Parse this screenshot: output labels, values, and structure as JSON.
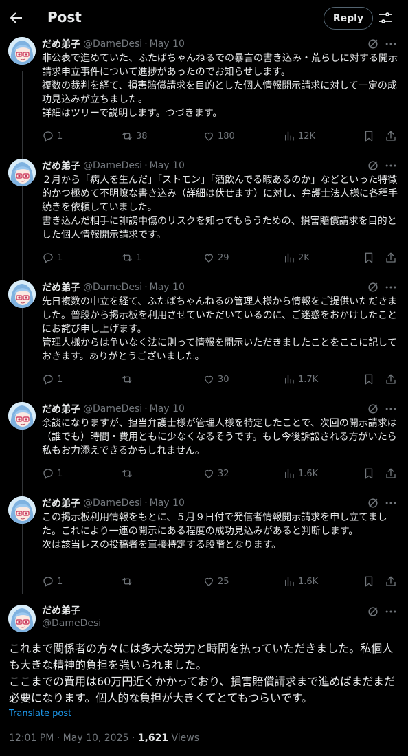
{
  "header": {
    "title": "Post",
    "reply_label": "Reply"
  },
  "author": {
    "name": "だめ弟子",
    "handle": "@DameDesi"
  },
  "thread": [
    {
      "date": "May 10",
      "text": "非公表で進めていた、ふたばちゃんねるでの暴言の書き込み・荒らしに対する開示請求申立事件について進捗があったのでお知らせします。\n複数の裁判を経て、損害賠償請求を目的とした個人情報開示請求に対して一定の成功見込みが立ちました。\n詳細はツリーで説明します。つづきます。",
      "replies": "1",
      "retweets": "38",
      "likes": "180",
      "views": "12K"
    },
    {
      "date": "May 10",
      "text": "２月から「病人を生んだ」「ストモン」「酒飲んでる暇あるのか」などといった特徴的かつ極めて不明瞭な書き込み（詳細は伏せます）に対し、弁護士法人様に各種手続きを依頼していました。\n書き込んだ相手に誹謗中傷のリスクを知ってもらうための、損害賠償請求を目的とした個人情報開示請求です。",
      "replies": "1",
      "retweets": "1",
      "likes": "29",
      "views": "2K"
    },
    {
      "date": "May 10",
      "text": "先日複数の申立を経て、ふたばちゃんねるの管理人様から情報をご提供いただきました。普段から掲示板を利用させていただいているのに、ご迷惑をおかけしたことにお詫び申し上げます。\n管理人様からは争いなく法に則って情報を開示いただきましたことをここに記しておきます。ありがとうございました。",
      "replies": "1",
      "retweets": "",
      "likes": "30",
      "views": "1.7K"
    },
    {
      "date": "May 10",
      "text": "余談になりますが、担当弁護士様が管理人様を特定したことで、次回の開示請求は（誰でも）時間・費用ともに少なくなるそうです。もし今後訴訟される方がいたら私もお力添えできるかもしれません。",
      "replies": "1",
      "retweets": "",
      "likes": "32",
      "views": "1.6K"
    },
    {
      "date": "May 10",
      "text": "この掲示板利用情報をもとに、５月９日付で発信者情報開示請求を申し立てました。これにより一連の開示にある程度の成功見込みがあると判断します。\n次は該当レスの投稿者を直接特定する段階となります。",
      "replies": "1",
      "retweets": "",
      "likes": "25",
      "views": "1.6K"
    }
  ],
  "main_post": {
    "text": "これまで関係者の方々には多大な労力と時間を払っていただきました。私個人も大きな精神的負担を強いられました。\nここまでの費用は60万円近くかかっており、損害賠償請求まで進めばまだまだ必要になります。個人的な負担が大きくてとてもつらいです。",
    "translate_label": "Translate post",
    "time": "12:01 PM · May 10, 2025 · ",
    "views_count": "1,621",
    "views_label": " Views"
  },
  "colors": {
    "background": "#000000",
    "text": "#e7e9ea",
    "muted": "#71767b",
    "link": "#1d9bf0",
    "line": "#333639"
  },
  "icons": [
    "back-arrow-icon",
    "filter-icon",
    "grok-icon",
    "more-icon",
    "reply-icon",
    "retweet-icon",
    "like-icon",
    "views-icon",
    "bookmark-icon",
    "share-icon"
  ]
}
